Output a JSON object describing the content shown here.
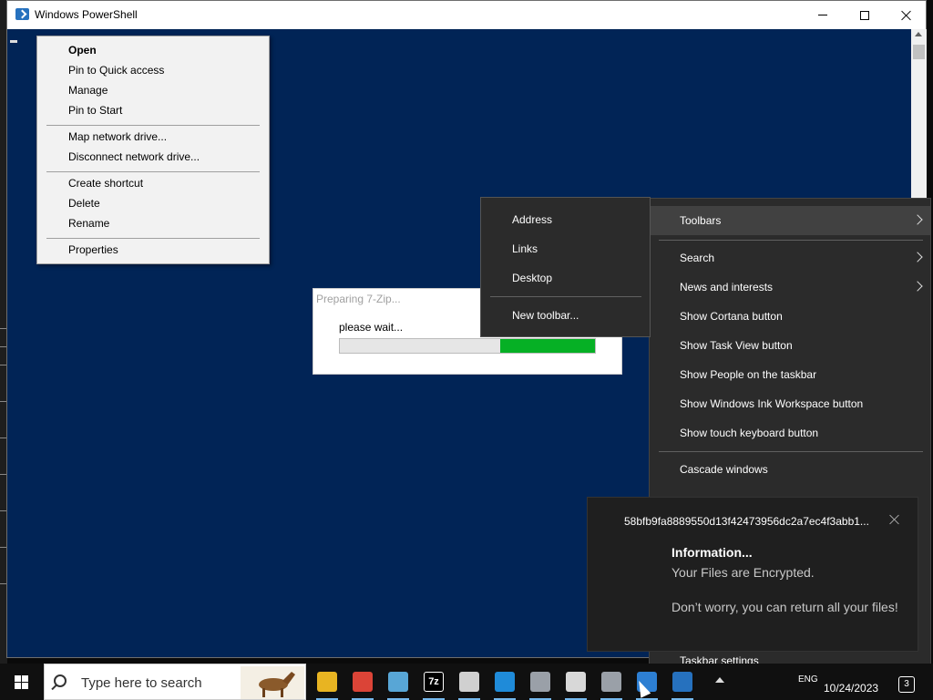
{
  "powershell": {
    "title": "Windows PowerShell"
  },
  "explorer_context_menu": {
    "groups": [
      [
        {
          "label": "Open",
          "bold": true
        },
        {
          "label": "Pin to Quick access"
        },
        {
          "label": "Manage"
        },
        {
          "label": "Pin to Start"
        }
      ],
      [
        {
          "label": "Map network drive..."
        },
        {
          "label": "Disconnect network drive..."
        }
      ],
      [
        {
          "label": "Create shortcut"
        },
        {
          "label": "Delete"
        },
        {
          "label": "Rename"
        }
      ],
      [
        {
          "label": "Properties"
        }
      ]
    ]
  },
  "zip_dialog": {
    "title": "Preparing 7-Zip...",
    "message": "please wait...",
    "progress_fill_start": 0.63,
    "progress_fill_end": 1.0
  },
  "toolbars_submenu": {
    "items": [
      "Address",
      "Links",
      "Desktop"
    ],
    "new_toolbar": "New toolbar..."
  },
  "taskbar_menu": {
    "toolbars": "Toolbars",
    "items": [
      {
        "label": "Search",
        "submenu": true
      },
      {
        "label": "News and interests",
        "submenu": true
      },
      {
        "label": "Show Cortana button"
      },
      {
        "label": "Show Task View button"
      },
      {
        "label": "Show People on the taskbar"
      },
      {
        "label": "Show Windows Ink Workspace button"
      },
      {
        "label": "Show touch keyboard button"
      }
    ],
    "cascade": "Cascade windows",
    "settings": "Taskbar settings"
  },
  "toast": {
    "header": "58bfb9fa8889550d13f42473956dc2a7ec4f3abb1...",
    "title": "Information...",
    "line1": "Your Files are Encrypted.",
    "line2": "Don’t worry, you can return all your files!"
  },
  "taskbar": {
    "search_placeholder": "Type here to search",
    "apps": [
      {
        "name": "file-explorer-icon",
        "color": "#e8b422",
        "glyph": ""
      },
      {
        "name": "chrome-icon",
        "color": "#db4437",
        "glyph": ""
      },
      {
        "name": "notepad-icon",
        "color": "#58a6d6",
        "glyph": ""
      },
      {
        "name": "7zip-icon",
        "color": "#ffffff",
        "glyph": "7z"
      },
      {
        "name": "window-app-icon",
        "color": "#d0d0d0",
        "glyph": ""
      },
      {
        "name": "edge-icon",
        "color": "#1f8bd9",
        "glyph": ""
      },
      {
        "name": "archive-icon",
        "color": "#9aa0a8",
        "glyph": ""
      },
      {
        "name": "folder-icon",
        "color": "#d8d8d8",
        "glyph": ""
      },
      {
        "name": "archive-icon",
        "color": "#9aa0a8",
        "glyph": ""
      },
      {
        "name": "installer-icon",
        "color": "#2d7fd3",
        "glyph": ""
      },
      {
        "name": "powershell-icon",
        "color": "#2671be",
        "glyph": ""
      }
    ],
    "lang": "ENG",
    "date": "10/24/2023",
    "notif_count": "3"
  }
}
